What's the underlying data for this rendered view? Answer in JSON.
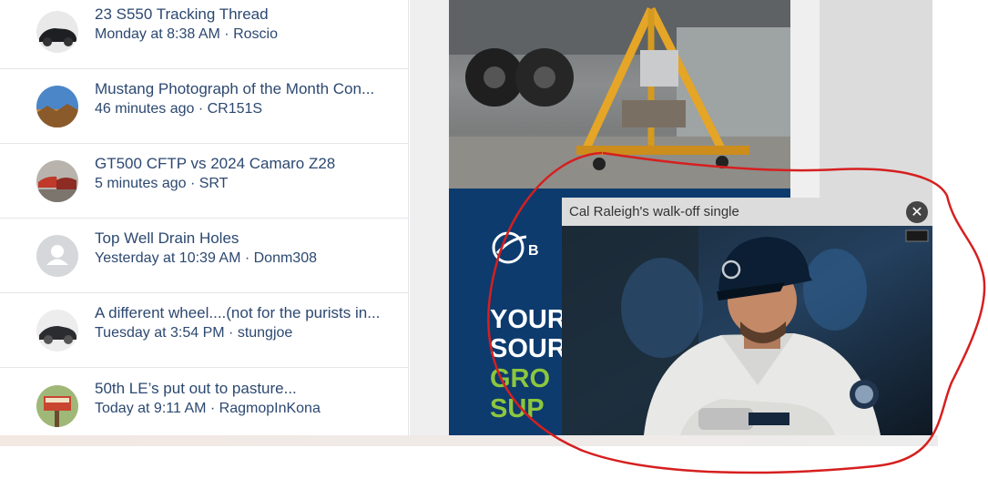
{
  "threads": [
    {
      "title": "23 S550 Tracking Thread",
      "meta": "Monday at 8:38 AM · Roscio",
      "avatar": "car-avatar-icon"
    },
    {
      "title": "Mustang Photograph of the Month Con...",
      "meta": "46 minutes ago · CR151S",
      "avatar": "landscape-avatar-icon"
    },
    {
      "title": "GT500 CFTP vs 2024 Camaro Z28",
      "meta": "5 minutes ago · SRT",
      "avatar": "cars-avatar-icon"
    },
    {
      "title": "Top Well Drain Holes",
      "meta": "Yesterday at 10:39 AM · Donm308",
      "avatar": "default-user-avatar-icon"
    },
    {
      "title": "A different wheel....(not for the purists in...",
      "meta": "Tuesday at 3:54 PM · stungjoe",
      "avatar": "car-avatar-icon"
    },
    {
      "title": "50th LE’s put out to pasture...",
      "meta": "Today at 9:11 AM · RagmopInKona",
      "avatar": "sign-avatar-icon"
    }
  ],
  "ad": {
    "line1": "YOUR",
    "line2": "SOUR",
    "line3": "GRO",
    "line4": "SUP",
    "logo_icon": "boeing-logo-icon"
  },
  "video": {
    "title": "Cal Raleigh's walk-off single",
    "close_symbol": "✕"
  },
  "colors": {
    "thread_text": "#2c4870",
    "ad_blue": "#0d3b6e",
    "ad_green": "#8cc63e",
    "annotation_red": "#d61f1f"
  }
}
